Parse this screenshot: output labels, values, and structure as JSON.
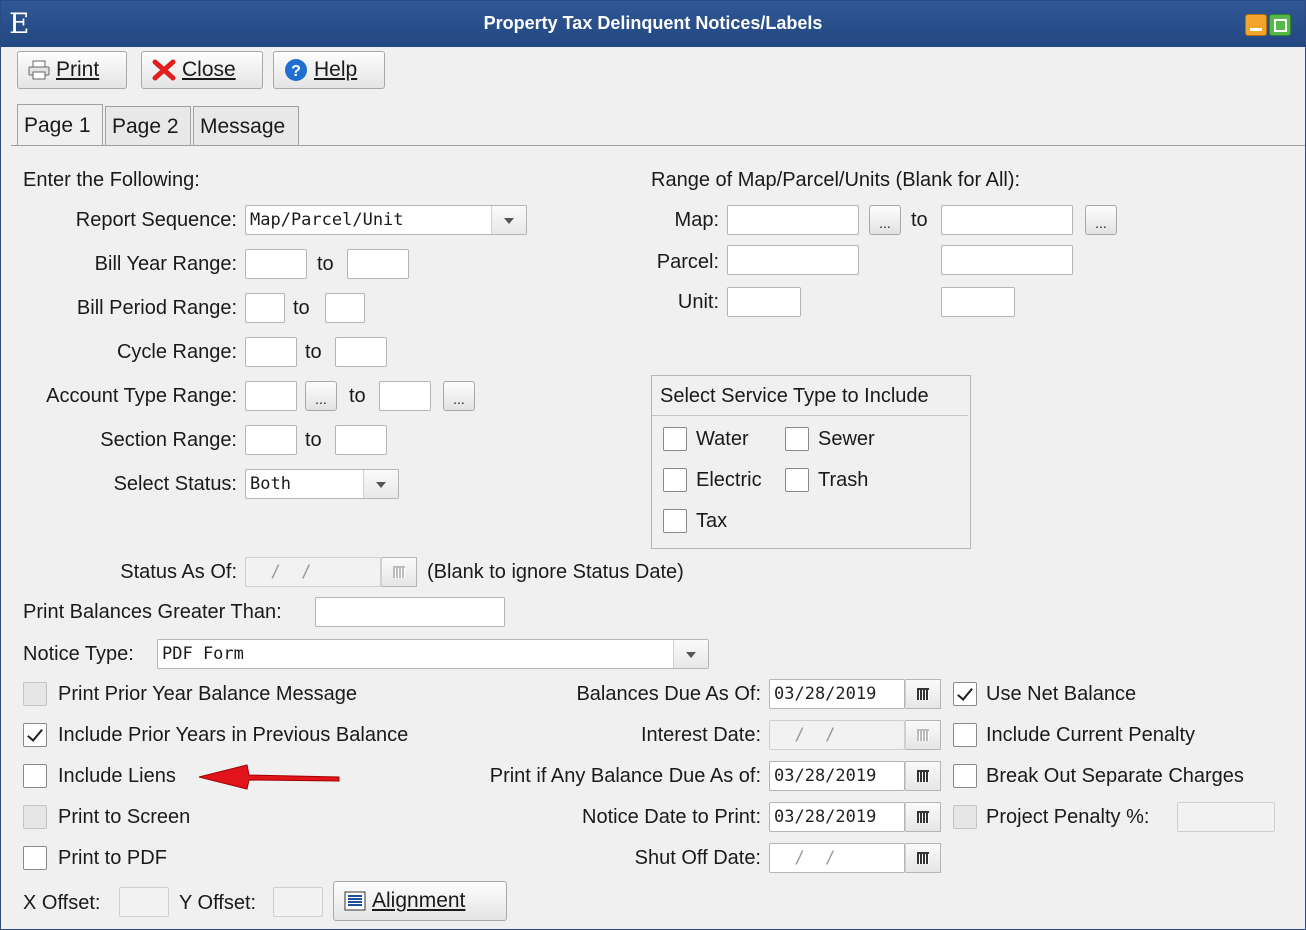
{
  "window": {
    "app_letter": "E",
    "title": "Property Tax Delinquent Notices/Labels"
  },
  "toolbar": {
    "print": "Print",
    "close": "Close",
    "help": "Help"
  },
  "tabs": [
    "Page 1",
    "Page 2",
    "Message"
  ],
  "left": {
    "heading": "Enter the Following:",
    "report_sequence_label": "Report Sequence:",
    "report_sequence_value": "Map/Parcel/Unit",
    "bill_year_label": "Bill Year Range:",
    "bill_period_label": "Bill Period Range:",
    "cycle_label": "Cycle Range:",
    "account_type_label": "Account Type Range:",
    "section_label": "Section Range:",
    "select_status_label": "Select Status:",
    "select_status_value": "Both",
    "to": "to",
    "ellipsis": "..."
  },
  "right": {
    "heading": "Range of Map/Parcel/Units (Blank for All):",
    "map_label": "Map:",
    "parcel_label": "Parcel:",
    "unit_label": "Unit:",
    "to": "to",
    "ellipsis": "..."
  },
  "service": {
    "title": "Select Service Type to Include",
    "water": "Water",
    "sewer": "Sewer",
    "electric": "Electric",
    "trash": "Trash",
    "tax": "Tax"
  },
  "status_as_of": {
    "label": "Status As Of:",
    "value": "  /  /",
    "hint": "(Blank to ignore Status Date)"
  },
  "print_balances": {
    "label": "Print Balances Greater Than:"
  },
  "notice_type": {
    "label": "Notice Type:",
    "value": "PDF Form"
  },
  "options_left": {
    "prior_year_msg": "Print Prior Year Balance Message",
    "include_prior_years": "Include Prior Years in Previous Balance",
    "include_liens": "Include Liens",
    "print_to_screen": "Print to Screen",
    "print_to_pdf": "Print to PDF"
  },
  "options_mid": {
    "balances_due_label": "Balances Due As Of:",
    "balances_due_value": "03/28/2019",
    "interest_date_label": "Interest Date:",
    "interest_date_value": "  /  /",
    "print_if_any_label": "Print if Any Balance Due As of:",
    "print_if_any_value": "03/28/2019",
    "notice_date_label": "Notice Date to Print:",
    "notice_date_value": "03/28/2019",
    "shut_off_label": "Shut Off Date:",
    "shut_off_value": "  /  /"
  },
  "options_right": {
    "use_net_balance": "Use Net Balance",
    "include_current_penalty": "Include Current Penalty",
    "break_out_charges": "Break Out Separate Charges",
    "project_penalty": "Project Penalty %:"
  },
  "offsets": {
    "x_label": "X Offset:",
    "y_label": "Y Offset:",
    "alignment": "Alignment"
  },
  "colors": {
    "titlebar": "#2f5895",
    "arrow": "#e0141a"
  }
}
